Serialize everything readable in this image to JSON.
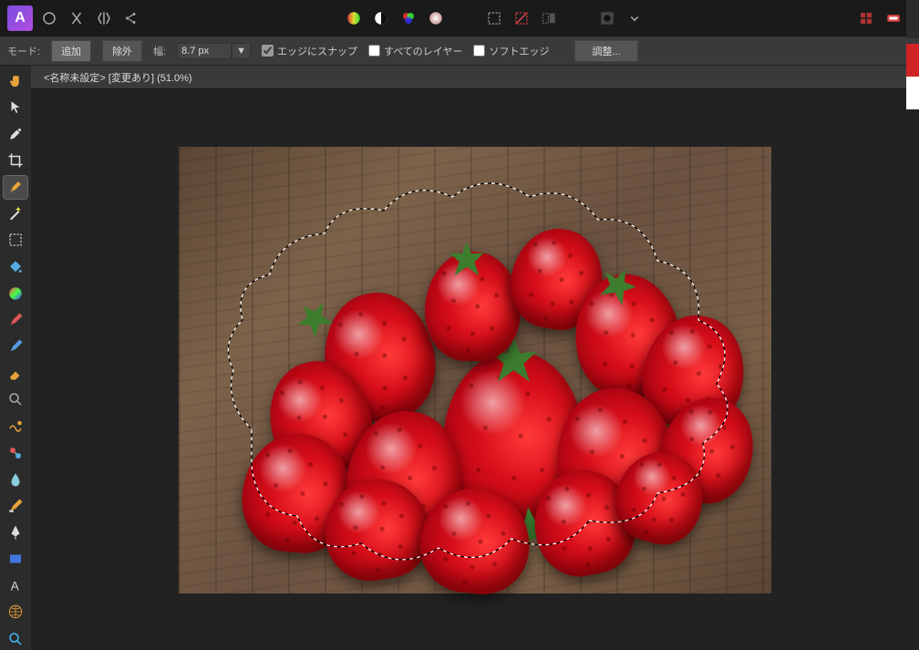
{
  "top_icons": [
    "app",
    "live",
    "align",
    "mirror",
    "share"
  ],
  "center_icons": [
    "gradient",
    "contrast",
    "rgb",
    "soft"
  ],
  "sel_icons": [
    "marquee",
    "diag",
    "crop-sel"
  ],
  "mask_icons": [
    "quick-mask"
  ],
  "right_icons": [
    "grid",
    "record"
  ],
  "context": {
    "mode_label": "モード:",
    "add": "追加",
    "remove": "除外",
    "width_label": "幅:",
    "width_value": "8.7 px",
    "snap": "エッジにスナップ",
    "all_layers": "すべてのレイヤー",
    "soft_edge": "ソフトエッジ",
    "adjust": "調整..."
  },
  "doc": {
    "title": "<名称未設定> [変更あり] (51.0%)"
  },
  "tools": [
    "hand",
    "pointer",
    "eyedropper",
    "crop",
    "brush-select",
    "wand",
    "marquee",
    "flood",
    "paint",
    "eraser",
    "clone",
    "heal",
    "zoom-tool",
    "liquify",
    "mesh",
    "blur",
    "burn",
    "pen",
    "rect",
    "text",
    "perspective",
    "search"
  ],
  "active_tool": "brush-select",
  "swatches": [
    "#d02424",
    "#ffffff"
  ]
}
